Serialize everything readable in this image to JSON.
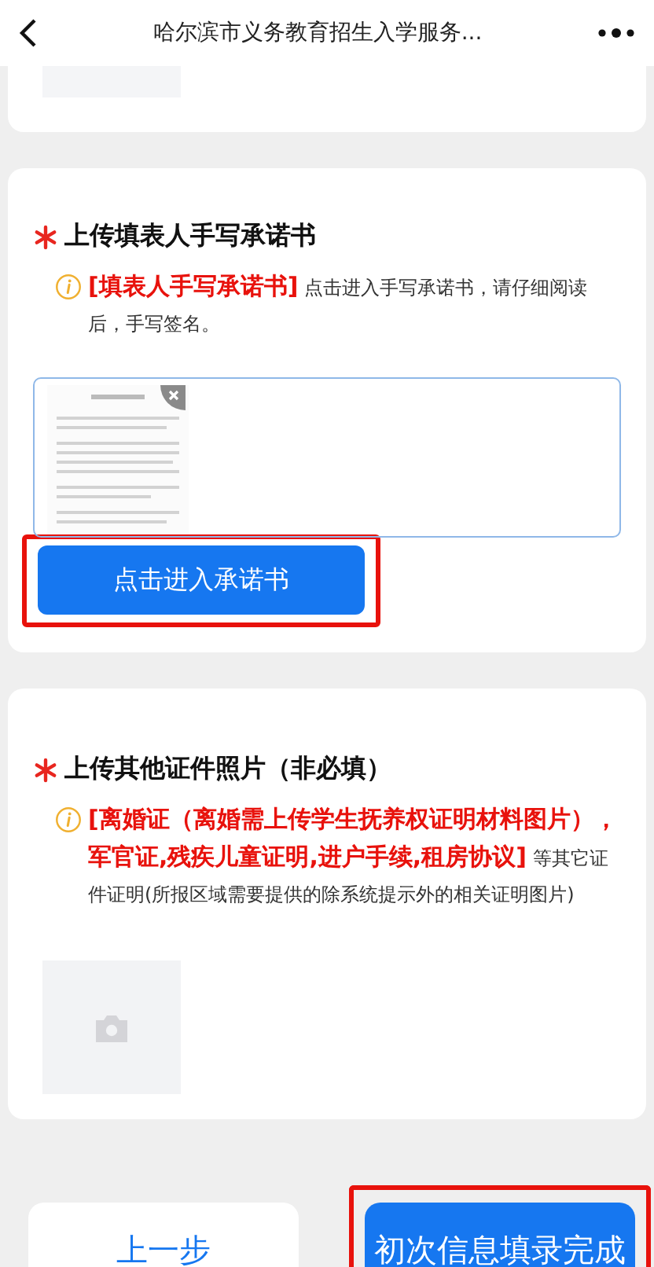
{
  "nav": {
    "title": "哈尔滨市义务教育招生入学服务..."
  },
  "sections": [
    {
      "kind": "signature",
      "required": true,
      "title": "上传填表人手写承诺书",
      "note": "**[填表人手写承诺书]** 点击进入手写承诺书，请仔细阅读后，手写签名。",
      "button": "点击进入承诺书",
      "highlighted": true
    },
    {
      "kind": "photo",
      "required": true,
      "title": "上传其他证件照片（非必填）",
      "note": "**[离婚证（离婚需上传学生抚养权证明材料图片），军官证,残疾儿童证明,进户手续,租房协议]** 等其它证件证明(所报区域需要提供的除系统提示外的相关证明图片)"
    }
  ],
  "footer": {
    "buttons": [
      {
        "kind": "secondary",
        "label": "上一步",
        "highlighted": false
      },
      {
        "kind": "primary",
        "label": "初次信息填录完成",
        "highlighted": true
      }
    ]
  }
}
